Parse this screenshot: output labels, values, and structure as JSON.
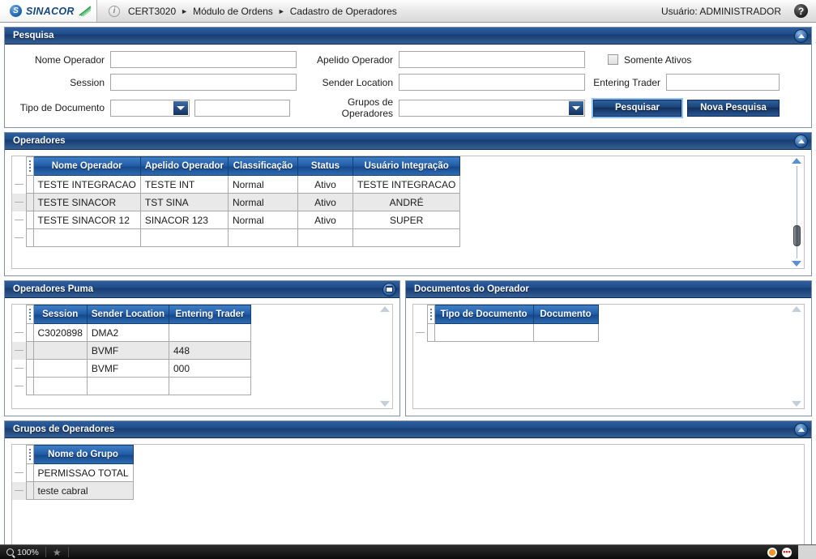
{
  "topbar": {
    "logo_text": "SINACOR",
    "logo_badge": "S",
    "info_icon": "i",
    "breadcrumb": [
      "CERT3020",
      "Módulo de Ordens",
      "Cadastro de Operadores"
    ],
    "crumb_arrow": "►",
    "user_label": "Usuário: ADMINISTRADOR",
    "help_icon": "?"
  },
  "pesquisa": {
    "title": "Pesquisa",
    "collapse_icon": "collapse-up",
    "labels": {
      "nome_operador": "Nome Operador",
      "session": "Session",
      "tipo_documento": "Tipo de Documento",
      "apelido_operador": "Apelido Operador",
      "sender_location": "Sender Location",
      "grupos_operadores": "Grupos de Operadores",
      "entering_trader": "Entering Trader",
      "somente_ativos": "Somente Ativos"
    },
    "values": {
      "nome_operador": "",
      "session": "",
      "tipo_documento": "",
      "documento": "",
      "apelido_operador": "",
      "sender_location": "",
      "grupos_operadores": "",
      "entering_trader": ""
    },
    "somente_ativos_checked": false,
    "buttons": {
      "pesquisar": "Pesquisar",
      "nova_pesquisa": "Nova Pesquisa"
    }
  },
  "operadores": {
    "title": "Operadores",
    "collapse_icon": "collapse-up",
    "columns": [
      "Nome Operador",
      "Apelido Operador",
      "Classificação",
      "Status",
      "Usuário Integração"
    ],
    "rows": [
      [
        "TESTE INTEGRACAO",
        "TESTE INT",
        "Normal",
        "Ativo",
        "TESTE INTEGRACAO"
      ],
      [
        "TESTE SINACOR",
        "TST SINA",
        "Normal",
        "Ativo",
        "ANDRÉ"
      ],
      [
        "TESTE SINACOR 12",
        "SINACOR 123",
        "Normal",
        "Ativo",
        "SUPER"
      ],
      [
        "",
        "",
        "",
        "",
        ""
      ]
    ]
  },
  "operadores_puma": {
    "title": "Operadores Puma",
    "restore_icon": "restore-window",
    "columns": [
      "Session",
      "Sender Location",
      "Entering Trader"
    ],
    "rows": [
      [
        "C3020898",
        "DMA2",
        ""
      ],
      [
        "",
        "BVMF",
        "448"
      ],
      [
        "",
        "BVMF",
        "000"
      ],
      [
        "",
        "",
        ""
      ]
    ]
  },
  "documentos_operador": {
    "title": "Documentos do Operador",
    "columns": [
      "Tipo de Documento",
      "Documento"
    ],
    "rows": [
      [
        "",
        ""
      ]
    ]
  },
  "grupos_operadores": {
    "title": "Grupos de Operadores",
    "collapse_icon": "collapse-up",
    "columns": [
      "Nome do Grupo"
    ],
    "rows": [
      [
        "PERMISSAO TOTAL"
      ],
      [
        "teste cabral"
      ]
    ]
  },
  "statusbar": {
    "zoom_level": "100%",
    "zoom_icon": "magnifier-icon",
    "favorite_icon": "star-icon",
    "indicator_amber": "amber-status-icon",
    "indicator_red": "red-status-icon",
    "red_glyph": "•••"
  },
  "colors": {
    "panel_header_blue": "#1f4c89",
    "grid_header_blue": "#1f5ba6",
    "button_blue": "#1c4479",
    "alt_row": "#e9e9e9",
    "status_bar": "#0b0b0b"
  }
}
